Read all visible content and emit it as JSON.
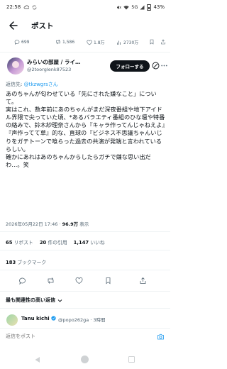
{
  "status_bar": {
    "time": "22:58",
    "network": "5G",
    "battery": "43%"
  },
  "header": {
    "title": "ポスト"
  },
  "previous_post_actions": {
    "replies": "699",
    "reposts": "1,586",
    "likes": "1.8万",
    "views": "2730万"
  },
  "author": {
    "name": "みらいの部屋 / ライ…",
    "handle": "@2toorgIenk87523",
    "follow_label": "フォローする"
  },
  "tweet": {
    "reply_prefix": "返信先: ",
    "reply_mention": "@tkzwgrsさん",
    "body": "あのちゃんが匂わせている「先にされた嫌なこと」について。\n実はこれ、数年前にあのちゃんがまだ深夜番組や地下アイドル界隈で尖っていた頃、*あるバラエティ番組のひな壇や特番の絡みで、鈴木紗理奈さんから『キャラ作ってんじゃねえよ』『声作ってて草』的な、直球の『ビジネス不思議ちゃんいじりをガチトーンで喰らった過去の共演が発端と言われているらしい。\n確かにあれはあのちゃんからしたらガチで嫌な思い出だわ…。笑",
    "timestamp": "2026年05月22日 17:46 · ",
    "views_value": "96.9万",
    "views_label": " 表示"
  },
  "stats": {
    "reposts_value": "65",
    "reposts_label": "リポスト",
    "quotes_value": "20",
    "quotes_label": "件の引用",
    "likes_value": "1,147",
    "likes_label": "いいね",
    "bookmarks_value": "183",
    "bookmarks_label": "ブックマーク"
  },
  "replies_section": {
    "sort_label": "最も関連性の高い返信",
    "first_reply": {
      "name": "Tanu kichi",
      "handle": "@popo262ga · 3時間"
    }
  },
  "compose": {
    "placeholder": "返信をポスト"
  },
  "colors": {
    "accent": "#1d9bf0",
    "text": "#0f1419",
    "muted": "#536471"
  }
}
